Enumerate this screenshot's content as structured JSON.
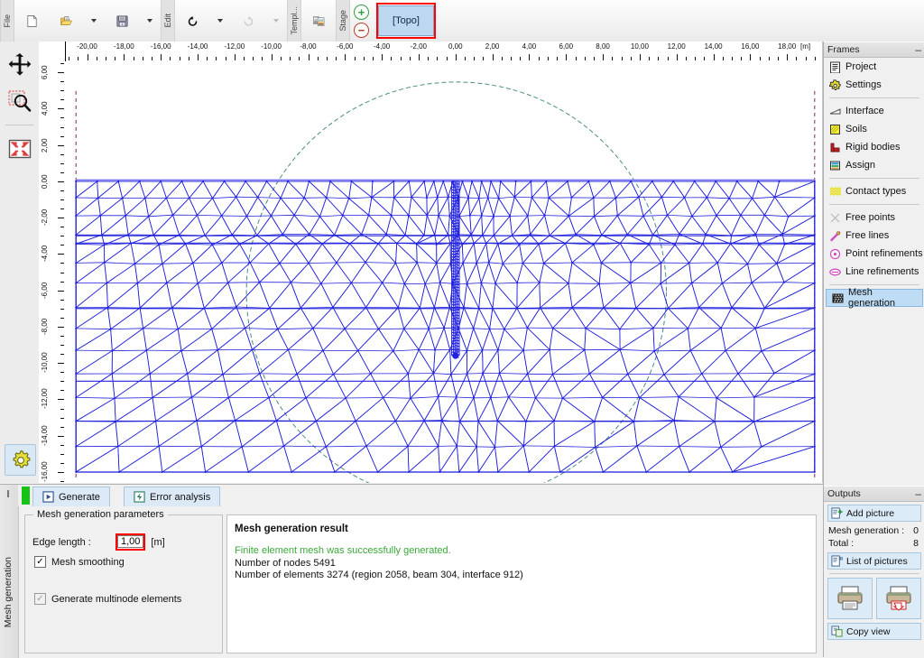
{
  "toolbar": {
    "groups": [
      {
        "label": "File",
        "name": "file"
      },
      {
        "label": "Edit",
        "name": "edit"
      },
      {
        "label": "Templ...",
        "name": "templates"
      },
      {
        "label": "Stage",
        "name": "stage"
      }
    ],
    "buttons": [
      {
        "name": "new-file-button",
        "icon": "new-document-icon",
        "title": "New"
      },
      {
        "name": "open-file-button",
        "icon": "open-folder-icon",
        "title": "Open"
      },
      {
        "name": "open-dropdown-button",
        "icon": "chevron-down-icon",
        "title": "Open options"
      },
      {
        "name": "save-file-button",
        "icon": "floppy-disk-icon",
        "title": "Save"
      },
      {
        "name": "save-dropdown-button",
        "icon": "chevron-down-icon",
        "title": "Save options"
      },
      {
        "name": "undo-button",
        "icon": "undo-arrow-icon",
        "title": "Undo"
      },
      {
        "name": "undo-dropdown-button",
        "icon": "chevron-down-icon",
        "title": "Undo list"
      },
      {
        "name": "redo-button",
        "icon": "redo-arrow-icon",
        "title": "Redo"
      },
      {
        "name": "redo-dropdown-button",
        "icon": "chevron-down-icon",
        "title": "Redo list"
      },
      {
        "name": "templates-button",
        "icon": "templates-icon",
        "title": "Templates"
      }
    ],
    "stage_add_label": "+",
    "stage_remove_label": "−",
    "topo_label": "[Topo]",
    "highlight_color": "#ff0000"
  },
  "left_rail": {
    "buttons": [
      {
        "name": "pan-tool",
        "icon": "move-arrows-icon"
      },
      {
        "name": "zoom-window-tool",
        "icon": "zoom-rectangle-icon"
      },
      {
        "name": "fit-to-view-tool",
        "icon": "fit-screen-icon"
      }
    ],
    "settings": {
      "name": "view-settings-button",
      "icon": "gear-icon"
    }
  },
  "drawing": {
    "unit_label": "[m]",
    "h_ruler": {
      "labels": [
        "-20,00",
        "-18,00",
        "-16,00",
        "-14,00",
        "-12,00",
        "-10,00",
        "-8,00",
        "-6,00",
        "-4,00",
        "-2,00",
        "0,00",
        "2,00",
        "4,00",
        "6,00",
        "8,00",
        "10,00",
        "12,00",
        "14,00",
        "16,00",
        "18,00"
      ],
      "values": [
        -20,
        -18,
        -16,
        -14,
        -12,
        -10,
        -8,
        -6,
        -4,
        -2,
        0,
        2,
        4,
        6,
        8,
        10,
        12,
        14,
        16,
        18
      ],
      "min": -21.2,
      "max": 19.9
    },
    "v_ruler": {
      "labels": [
        "6,00",
        "4,00",
        "2,00",
        "0,00",
        "-2,00",
        "-4,00",
        "-6,00",
        "-8,00",
        "-10,00",
        "-12,00",
        "-14,00",
        "-16,00"
      ],
      "values": [
        6,
        4,
        2,
        0,
        -2,
        -4,
        -6,
        -8,
        -10,
        -12,
        -14,
        -16
      ],
      "min": -16.6,
      "max": 6.6
    },
    "colors": {
      "mesh": "#2222dd",
      "mesh_light": "#7b7bee",
      "boundary": "#8a1a6a",
      "slip_surface": "#4e8b85",
      "background": "#ffffff"
    },
    "geometry": {
      "ground_level_y": 0.0,
      "mesh_left_x": -20.6,
      "mesh_right_x": 19.5,
      "mesh_bottom_y": -16.0,
      "pile_x": 0.0,
      "pile_bottom_y": -9.6,
      "soil_layer_levels": [
        -3.0,
        -3.4,
        -7.0,
        -11.0,
        -13.2
      ],
      "slip_circle_center_x": 0.05,
      "slip_circle_center_y": -6.1,
      "slip_circle_radius": 11.4
    }
  },
  "frames_panel": {
    "title": "Frames",
    "minimize_label": "–",
    "groups": [
      {
        "items": [
          {
            "label": "Project",
            "icon": "project-icon",
            "name": "frame-project",
            "selected": false
          },
          {
            "label": "Settings",
            "icon": "settings-gear-icon",
            "name": "frame-settings",
            "selected": false
          }
        ]
      },
      {
        "items": [
          {
            "label": "Interface",
            "icon": "interface-icon",
            "name": "frame-interface",
            "selected": false
          },
          {
            "label": "Soils",
            "icon": "soils-icon",
            "name": "frame-soils",
            "selected": false
          },
          {
            "label": "Rigid bodies",
            "icon": "rigid-bodies-icon",
            "name": "frame-rigid-bodies",
            "selected": false
          },
          {
            "label": "Assign",
            "icon": "assign-icon",
            "name": "frame-assign",
            "selected": false
          }
        ]
      },
      {
        "items": [
          {
            "label": "Contact types",
            "icon": "contact-types-icon",
            "name": "frame-contact-types",
            "selected": false
          }
        ]
      },
      {
        "items": [
          {
            "label": "Free points",
            "icon": "free-points-icon",
            "name": "frame-free-points",
            "selected": false
          },
          {
            "label": "Free lines",
            "icon": "free-lines-icon",
            "name": "frame-free-lines",
            "selected": false
          },
          {
            "label": "Point refinements",
            "icon": "point-refinements-icon",
            "name": "frame-point-refinements",
            "selected": false
          },
          {
            "label": "Line refinements",
            "icon": "line-refinements-icon",
            "name": "frame-line-refinements",
            "selected": false
          }
        ]
      },
      {
        "items": [
          {
            "label": "Mesh generation",
            "icon": "mesh-generation-icon",
            "name": "frame-mesh-generation",
            "selected": true
          }
        ]
      }
    ]
  },
  "outputs_panel": {
    "title": "Outputs",
    "minimize_label": "–",
    "add_picture_label": "Add picture",
    "rows": [
      {
        "label": "Mesh generation :",
        "value": "0"
      },
      {
        "label": "Total :",
        "value": "8"
      }
    ],
    "list_of_pictures_label": "List of pictures",
    "print_button_label": "print-document",
    "print_view_button_label": "print-view",
    "copy_view_label": "Copy view"
  },
  "bottom_panel": {
    "side_label": "Mesh generation",
    "tabs": [
      {
        "label": "Generate",
        "name": "tab-generate",
        "icon": "play-icon",
        "active": true
      },
      {
        "label": "Error analysis",
        "name": "tab-error-analysis",
        "icon": "error-analysis-icon",
        "active": false
      }
    ],
    "parameters": {
      "group_title": "Mesh generation parameters",
      "edge_length_label": "Edge length :",
      "edge_length_value": "1,00",
      "edge_length_unit": "[m]",
      "mesh_smoothing_label": "Mesh smoothing",
      "mesh_smoothing_checked": true,
      "multinode_label": "Generate multinode elements",
      "multinode_checked": true,
      "multinode_disabled": true
    },
    "result": {
      "title": "Mesh generation result",
      "success_text": "Finite element mesh was successfully generated.",
      "lines": [
        "Number of nodes 5491",
        "Number of elements 3274 (region 2058, beam 304, interface 912)"
      ]
    }
  }
}
